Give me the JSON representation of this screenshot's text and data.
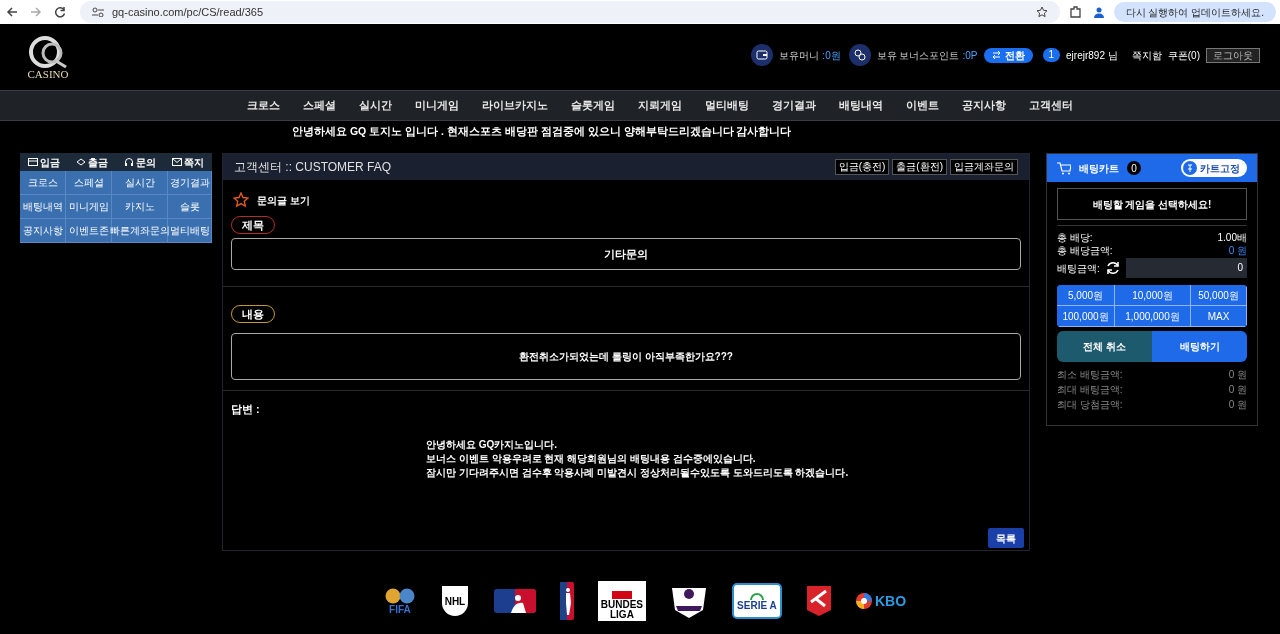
{
  "browser": {
    "url": "gq-casino.com/pc/CS/read/365",
    "update_button": "다시 실행하여 업데이트하세요."
  },
  "header": {
    "logo_text": "CASINO",
    "money_label": "보유머니",
    "money_value": ":0원",
    "bonus_label": "보유 보너스포인트",
    "bonus_value": ":0P",
    "convert_button": "전환",
    "level_badge": "1",
    "username": "ejrejr892 님",
    "messages": "쪽지함",
    "coupons": "쿠폰(0)",
    "logout_button": "로그아웃"
  },
  "nav": [
    "크로스",
    "스페셜",
    "실시간",
    "미니게임",
    "라이브카지노",
    "슬롯게임",
    "지뢰게임",
    "멀티배팅",
    "경기결과",
    "배팅내역",
    "이벤트",
    "공지사항",
    "고객센터"
  ],
  "notice": "안녕하세요 GQ 토지노 입니다 . 현재스포츠 배당판 점검중에 있으니 양해부탁드리겠습니다 감사합니다",
  "quick_menu": {
    "top": [
      {
        "kind": "card",
        "label": "입금"
      },
      {
        "kind": "wallet",
        "label": "출금"
      },
      {
        "kind": "headset",
        "label": "문의"
      },
      {
        "kind": "mail",
        "label": "쪽지"
      }
    ],
    "grid": [
      "크로스",
      "스페셜",
      "실시간",
      "경기결과",
      "배팅내역",
      "미니게임",
      "카지노",
      "슬롯",
      "공지사항",
      "이벤트존",
      "빠른계좌문의",
      "멀티배팅"
    ]
  },
  "panel": {
    "title": "고객센터 :: CUSTOMER FAQ",
    "header_buttons": [
      "입금(충전)",
      "출금(환전)",
      "입금계좌문의"
    ],
    "subtitle": "문의글 보기",
    "subject_label": "제목",
    "subject": "기타문의",
    "content_label": "내용",
    "content": "환전취소가되었는데 롤링이 아직부족한가요???",
    "answer_label": "답변 :",
    "answer_lines": [
      "안녕하세요 GQ카지노입니다.",
      "보너스 이벤트 악용우려로 현재 해당회원님의 배팅내용 검수중에있습니다.",
      "잠시만 기다려주시면 검수후 악용사례 미발견시 정상처리될수있도록 도와드리도록 하겠습니다."
    ],
    "list_button": "목록"
  },
  "cart": {
    "title": "배팅카트",
    "count": "0",
    "pin_button": "카트고정",
    "empty_message": "배팅할 게임을 선택하세요!",
    "total_odds_label": "총 배당:",
    "total_odds": "1.00배",
    "total_payout_label": "총 배당금액:",
    "total_payout": "0 원",
    "bet_amount_label": "배팅금액:",
    "bet_amount": "0",
    "amount_buttons": [
      "5,000원",
      "10,000원",
      "50,000원",
      "100,000원",
      "1,000,000원",
      "MAX"
    ],
    "cancel_button": "전체 취소",
    "bet_button": "배팅하기",
    "limits": [
      {
        "label": "최소 배팅금액:",
        "value": "0 원"
      },
      {
        "label": "최대 배팅금액:",
        "value": "0 원"
      },
      {
        "label": "최대 당첨금액:",
        "value": "0 원"
      }
    ]
  },
  "footer_logos": [
    {
      "kind": "fifa",
      "label": "FIFA"
    },
    {
      "kind": "nhl",
      "label": "NHL"
    },
    {
      "kind": "mlb"
    },
    {
      "kind": "nba"
    },
    {
      "kind": "bundesliga",
      "label": "BUNDES LIGA"
    },
    {
      "kind": "premier"
    },
    {
      "kind": "seriea",
      "label": "SERIE A"
    },
    {
      "kind": "kleague"
    },
    {
      "kind": "kbo",
      "label": "KBO"
    }
  ]
}
